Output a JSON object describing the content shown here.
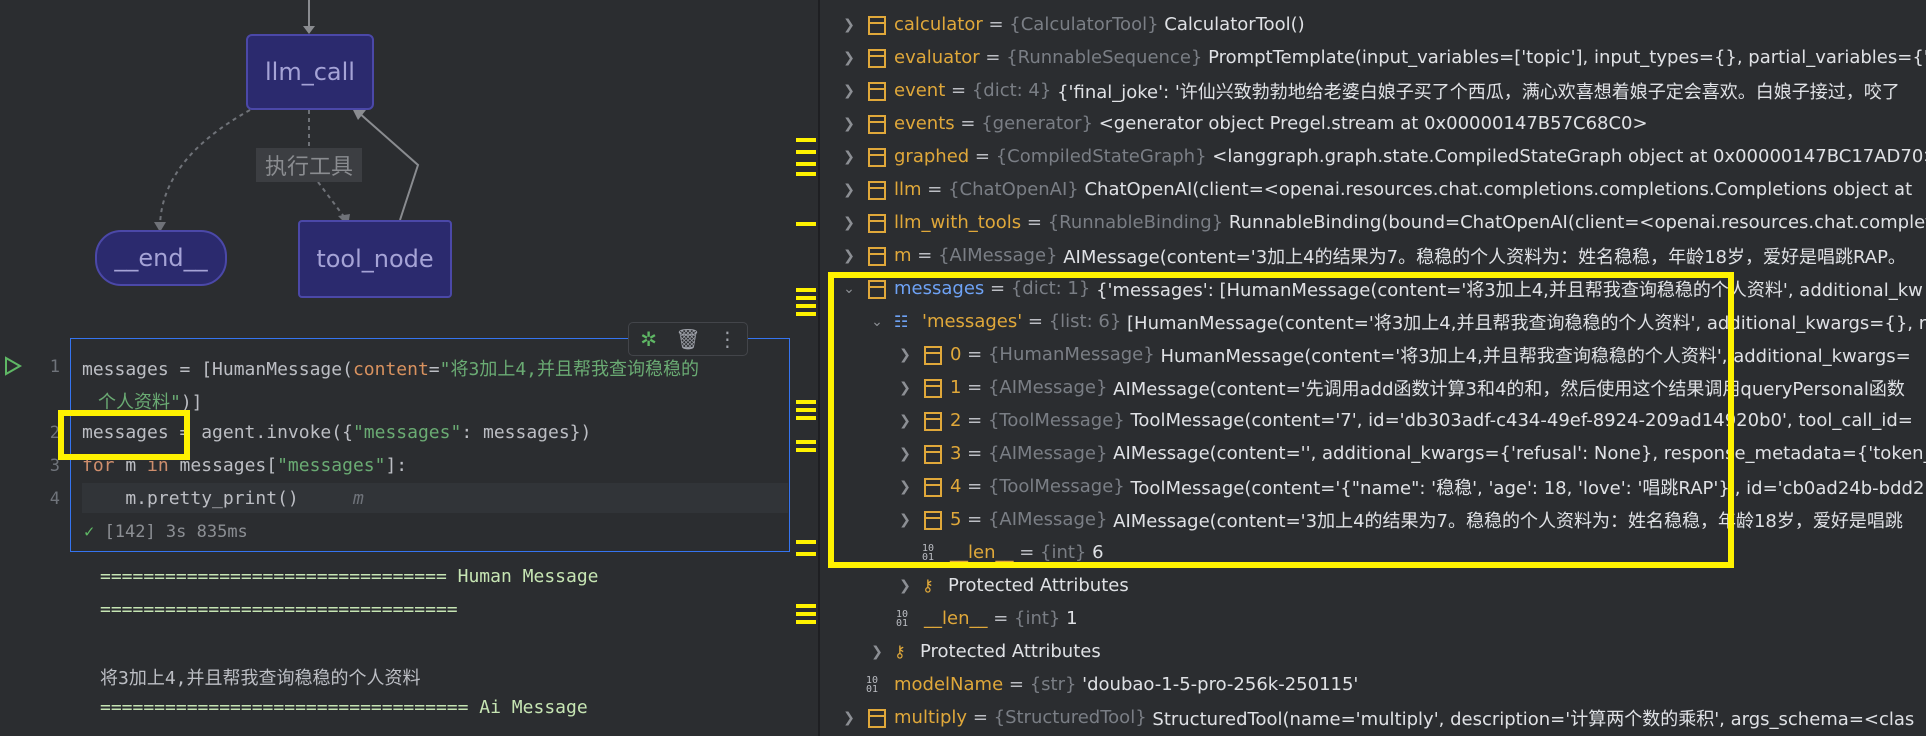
{
  "graph": {
    "nodes": {
      "llm_call": "llm_call",
      "end": "__end__",
      "tool_node": "tool_node"
    },
    "edge_label": "执行工具"
  },
  "cell": {
    "line_numbers": [
      "1",
      "2",
      "3",
      "4"
    ],
    "line1_a": "messages = [HumanMessage(",
    "line1_param": "content",
    "line1_eq": "=",
    "line1_str": "\"将3加上4,并且帮我查询稳稳的",
    "line1_cont_str": "个人资料\"",
    "line1_cont_end": ")]",
    "line2_var": "messages",
    "line2_rest_a": " = agent.invoke({",
    "line2_str": "\"messages\"",
    "line2_rest_b": ": messages})",
    "line3_for": "for",
    "line3_mid": " m ",
    "line3_in": "in",
    "line3_b": " messages[",
    "line3_str": "\"messages\"",
    "line3_c": "]:",
    "line4": "    m.pretty_print()",
    "line4_hint": "m",
    "status": "[142] 3s 835ms"
  },
  "output": {
    "line1": "================================ Human Message",
    "line2": "=================================",
    "line3": "将3加上4,并且帮我查询稳稳的个人资料",
    "line4": "================================== Ai Message"
  },
  "debugger": {
    "rows": [
      {
        "name": "calculator",
        "type": "{CalculatorTool}",
        "value": "CalculatorTool()"
      },
      {
        "name": "evaluator",
        "type": "{RunnableSequence}",
        "value": "PromptTemplate(input_variables=['topic'], input_types={}, partial_variables={'fo"
      },
      {
        "name": "event",
        "type": "{dict: 4}",
        "value": "{'final_joke': '许仙兴致勃勃地给老婆白娘子买了个西瓜，满心欢喜想着娘子定会喜欢。白娘子接过，咬了"
      },
      {
        "name": "events",
        "type": "{generator}",
        "value": "<generator object Pregel.stream at 0x00000147B57C68C0>"
      },
      {
        "name": "graphed",
        "type": "{CompiledStateGraph}",
        "value": "<langgraph.graph.state.CompiledStateGraph object at 0x00000147BC17AD70>"
      },
      {
        "name": "llm",
        "type": "{ChatOpenAI}",
        "value": "ChatOpenAI(client=<openai.resources.chat.completions.completions.Completions object at"
      },
      {
        "name": "llm_with_tools",
        "type": "{RunnableBinding}",
        "value": "RunnableBinding(bound=ChatOpenAI(client=<openai.resources.chat.completions.compl"
      },
      {
        "name": "m",
        "type": "{AIMessage}",
        "value": "AIMessage(content='3加上4的结果为7。稳稳的个人资料为：姓名稳稳，年龄18岁，爱好是唱跳RAP。"
      },
      {
        "name": "messages",
        "type": "{dict: 1}",
        "value": "{'messages': [HumanMessage(content='将3加上4,并且帮我查询稳稳的个人资料', additional_kw"
      },
      {
        "name": "'messages'",
        "type": "{list: 6}",
        "value": "[HumanMessage(content='将3加上4,并且帮我查询稳稳的个人资料', additional_kwargs={}, r"
      },
      {
        "name": "0",
        "type": "{HumanMessage}",
        "value": "HumanMessage(content='将3加上4,并且帮我查询稳稳的个人资料', additional_kwargs="
      },
      {
        "name": "1",
        "type": "{AIMessage}",
        "value": "AIMessage(content='先调用add函数计算3和4的和，然后使用这个结果调用queryPersonal函数"
      },
      {
        "name": "2",
        "type": "{ToolMessage}",
        "value": "ToolMessage(content='7', id='db303adf-c434-49ef-8924-209ad14920b0', tool_call_id="
      },
      {
        "name": "3",
        "type": "{AIMessage}",
        "value": "AIMessage(content='', additional_kwargs={'refusal': None}, response_metadata={'token_"
      },
      {
        "name": "4",
        "type": "{ToolMessage}",
        "value": "ToolMessage(content='{\"name\": '稳稳', 'age': 18, 'love': '唱跳RAP'}', id='cb0ad24b-bdd2"
      },
      {
        "name": "5",
        "type": "{AIMessage}",
        "value": "AIMessage(content='3加上4的结果为7。稳稳的个人资料为：姓名稳稳，年龄18岁，爱好是唱跳"
      },
      {
        "name": "__len__",
        "type": "{int}",
        "value": "6"
      },
      {
        "name": "Protected Attributes",
        "type": "",
        "value": ""
      },
      {
        "name": "__len__",
        "type": "{int}",
        "value": "1"
      },
      {
        "name": "Protected Attributes",
        "type": "",
        "value": ""
      },
      {
        "name": "modelName",
        "type": "{str}",
        "value": "'doubao-1-5-pro-256k-250115'"
      },
      {
        "name": "multiply",
        "type": "{StructuredTool}",
        "value": "StructuredTool(name='multiply', description='计算两个数的乘积', args_schema=<clas"
      }
    ]
  },
  "colors": {
    "highlight": "#fff200",
    "node_fill": "#2b2a6e"
  }
}
